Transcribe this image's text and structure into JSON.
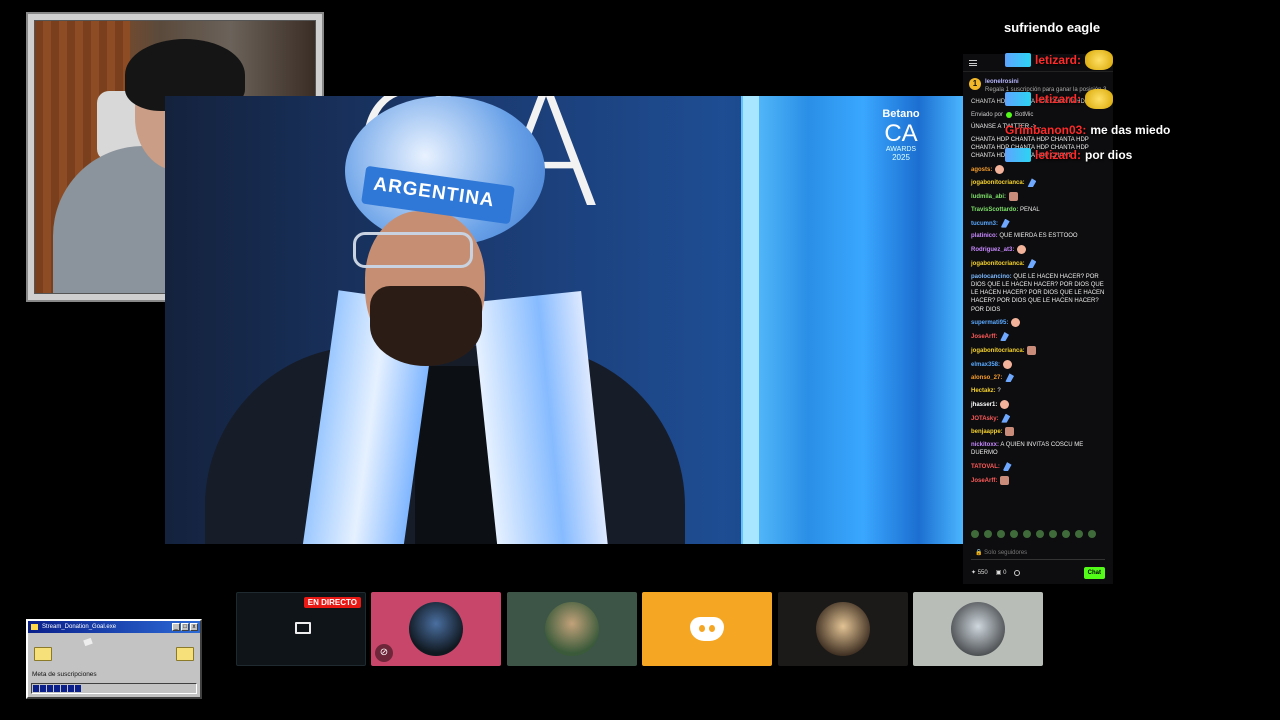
{
  "overlay": {
    "title": "sufriendo eagle",
    "lines": [
      {
        "user": "letizard:",
        "text": ""
      },
      {
        "user": "letizard:",
        "text": ""
      },
      {
        "user": "Grimbanon03:",
        "text": "me das miedo"
      },
      {
        "user": "letizard:",
        "text": "por dios"
      }
    ]
  },
  "video": {
    "letters": "CA",
    "band_text": "ARGENTINA",
    "logo_brand": "Betano",
    "logo_ca": "CA",
    "logo_sub": "AWARDS",
    "logo_year": "2025"
  },
  "chat": {
    "pinned_user": "leonelrosini",
    "pinned_text": "Regala 1 suscripción para ganar la posición 3",
    "pinned_count": "1",
    "banner": "CHANTA HDP CHANTA HDP CHANTA HDP",
    "sent_label": "Enviado por",
    "sent_user": "BotMic",
    "messages": [
      {
        "user": "",
        "color": "#ffffff",
        "text": "ÚNANSE A TWITTER ->..."
      },
      {
        "user": "",
        "color": "#ffffff",
        "text": "CHANTA HDP CHANTA HDP CHANTA HDP CHANTA HDP CHANTA HDP CHANTA HDP CHANTA HDP CHANTA HDP CHANT"
      },
      {
        "user": "agosts:",
        "color": "#f59c2d",
        "text": ""
      },
      {
        "user": "jogabonitocrianca:",
        "color": "#f5d22d",
        "text": ""
      },
      {
        "user": "ludmila_abi:",
        "color": "#7ee06a",
        "text": ""
      },
      {
        "user": "TravisScottardo:",
        "color": "#7ee06a",
        "text": "PENAL"
      },
      {
        "user": "tucumn3:",
        "color": "#5aa9ff",
        "text": ""
      },
      {
        "user": "platinico:",
        "color": "#c889ff",
        "text": "QUE MIERDA ES ESTTOOO"
      },
      {
        "user": "Rodriguez_at3:",
        "color": "#c889ff",
        "text": ""
      },
      {
        "user": "jogabonitocrianca:",
        "color": "#f5d22d",
        "text": ""
      },
      {
        "user": "paolocancino:",
        "color": "#7ab8ff",
        "text": "QUE LE HACEN HACER? POR DIOS QUE LE HACEN HACER? POR DIOS QUE LE HACEN HACER? POR DIOS QUE LE HACEN HACER? POR DIOS QUE LE HACEN HACER? POR DIOS"
      },
      {
        "user": "supermati95:",
        "color": "#5aa9ff",
        "text": ""
      },
      {
        "user": "JoseArff:",
        "color": "#ff5a5a",
        "text": ""
      },
      {
        "user": "jogabonitocrianca:",
        "color": "#f5d22d",
        "text": ""
      },
      {
        "user": "elmax358:",
        "color": "#5aa9ff",
        "text": ""
      },
      {
        "user": "alonso_27:",
        "color": "#f59c2d",
        "text": ""
      },
      {
        "user": "Hectakz:",
        "color": "#f5d22d",
        "text": "?"
      },
      {
        "user": "jhasser1:",
        "color": "#ffffff",
        "text": ""
      },
      {
        "user": "JOTAsky:",
        "color": "#ff5a5a",
        "text": ""
      },
      {
        "user": "benjaappe:",
        "color": "#f5d22d",
        "text": ""
      },
      {
        "user": "nickitoxx:",
        "color": "#c889ff",
        "text": "A QUIEN INVITAS COSCU ME DUERMO"
      },
      {
        "user": "TATOVAL:",
        "color": "#ff5a5a",
        "text": ""
      },
      {
        "user": "JoseArff:",
        "color": "#ff5a5a",
        "text": ""
      }
    ],
    "input_placeholder": "Solo seguidores",
    "points": "550",
    "gifts": "0",
    "send_label": "Chat"
  },
  "tiles": {
    "live_label": "EN DIRECTO"
  },
  "donation_window": {
    "title": "Stream_Donation_Goal.exe",
    "label": "Meta de suscripciones",
    "progress": 0.3
  }
}
